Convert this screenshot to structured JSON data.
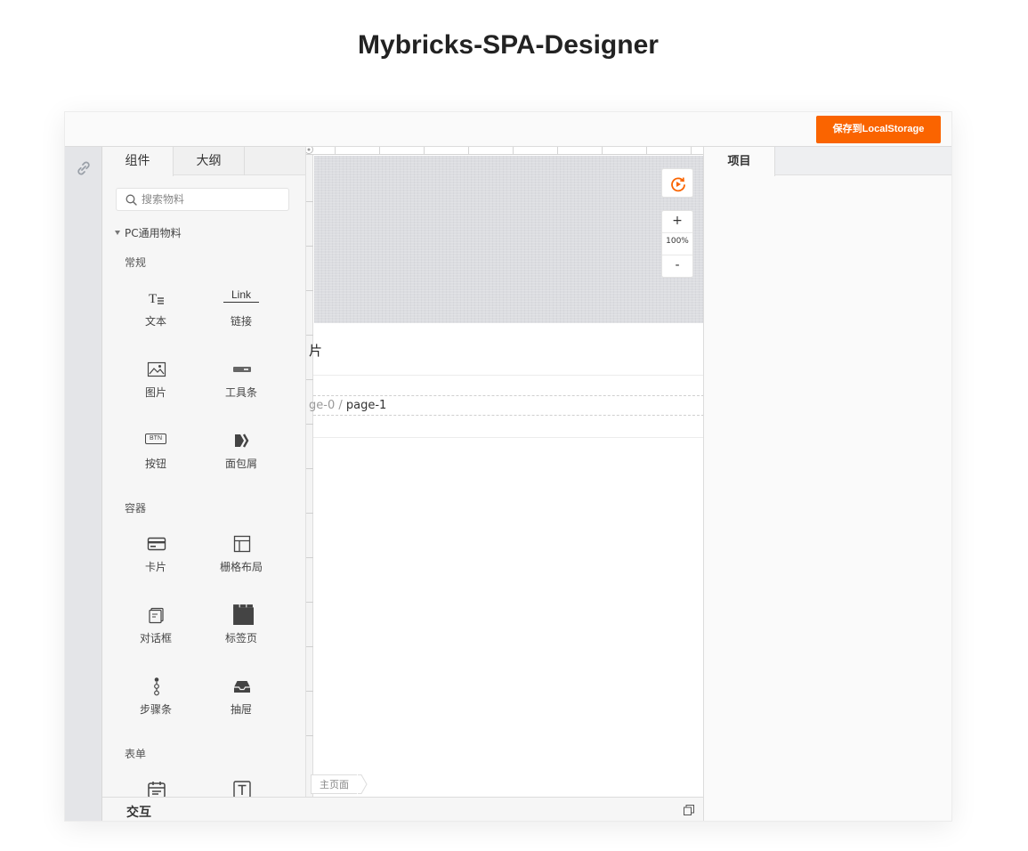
{
  "page": {
    "title": "Mybricks-SPA-Designer"
  },
  "toolbar": {
    "save_label": "保存到LocalStorage",
    "accent": "#fa6400"
  },
  "left_strip": {
    "icon": "link-icon"
  },
  "components_panel": {
    "tabs": [
      {
        "label": "组件"
      },
      {
        "label": "大纲"
      }
    ],
    "search_placeholder": "搜索物料",
    "group": "PC通用物料",
    "sections": [
      {
        "title": "常规",
        "items": [
          {
            "label": "文本",
            "icon": "text-icon"
          },
          {
            "label": "链接",
            "icon": "link-text-icon"
          },
          {
            "label": "图片",
            "icon": "image-icon"
          },
          {
            "label": "工具条",
            "icon": "toolbar-icon"
          },
          {
            "label": "按钮",
            "icon": "button-icon"
          },
          {
            "label": "面包屑",
            "icon": "breadcrumb-icon"
          }
        ]
      },
      {
        "title": "容器",
        "items": [
          {
            "label": "卡片",
            "icon": "card-icon"
          },
          {
            "label": "栅格布局",
            "icon": "grid-layout-icon"
          },
          {
            "label": "对话框",
            "icon": "dialog-icon"
          },
          {
            "label": "标签页",
            "icon": "tabs-icon"
          },
          {
            "label": "步骤条",
            "icon": "steps-icon"
          },
          {
            "label": "抽屉",
            "icon": "drawer-icon"
          }
        ]
      },
      {
        "title": "表单",
        "items": [
          {
            "label": "",
            "icon": "calendar-icon"
          },
          {
            "label": "",
            "icon": "text-input-icon"
          }
        ]
      }
    ],
    "link_glyph_text": "Link",
    "button_glyph_text": "BTN"
  },
  "canvas": {
    "zoom": "100%",
    "zoom_in": "+",
    "zoom_out": "-",
    "partial_text": "片",
    "breadcrumb": {
      "prev": "ge-0",
      "separator": "/",
      "current": "page-1"
    },
    "page_tag": "主页面"
  },
  "bottom_panel": {
    "title": "交互"
  },
  "right_panel": {
    "tabs": [
      {
        "label": "项目"
      }
    ]
  }
}
